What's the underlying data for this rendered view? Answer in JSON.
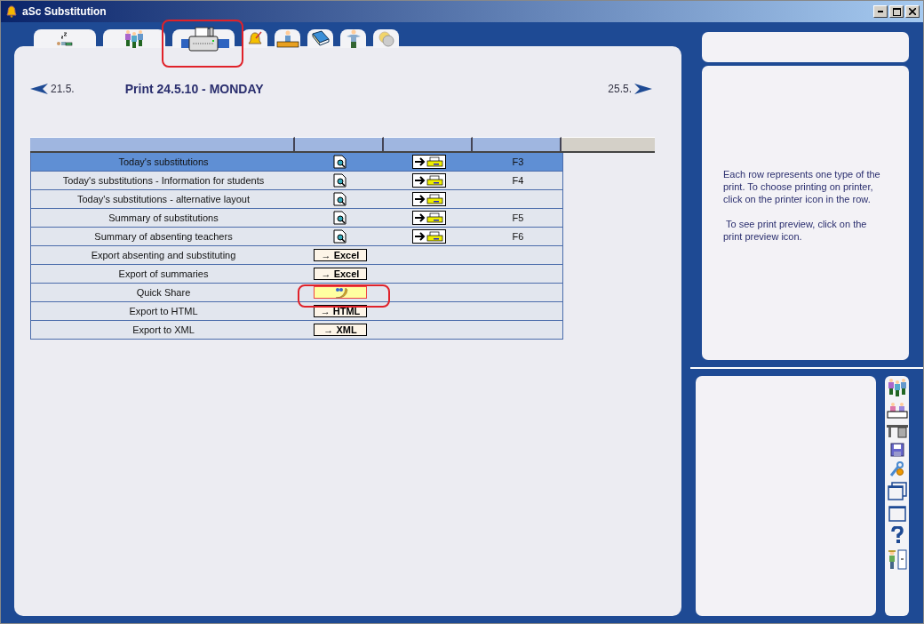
{
  "window": {
    "title": "aSc Substitution"
  },
  "tabs": [
    {
      "selected": false
    },
    {
      "selected": false
    },
    {
      "selected": true
    },
    {
      "selected": false
    },
    {
      "selected": false
    },
    {
      "selected": false
    },
    {
      "selected": false
    },
    {
      "selected": false
    }
  ],
  "nav": {
    "prev": "21.5.",
    "title": "Print 24.5.10 - MONDAY",
    "next": "25.5."
  },
  "rows": [
    {
      "kind": "print",
      "label": "Today's substitutions",
      "key": "F3",
      "selected": true
    },
    {
      "kind": "print",
      "label": "Today's substitutions - Information for students",
      "key": "F4",
      "selected": false
    },
    {
      "kind": "print",
      "label": "Today's substitutions - alternative layout",
      "selected": false
    },
    {
      "kind": "print",
      "label": "Summary of substitutions",
      "key": "F5",
      "selected": false
    },
    {
      "kind": "print",
      "label": "Summary of absenting teachers",
      "key": "F6",
      "selected": false
    },
    {
      "kind": "export",
      "label": "Export absenting and substituting",
      "button": "→ Excel",
      "selected": false
    },
    {
      "kind": "export",
      "label": "Export of summaries",
      "button": "→ Excel",
      "selected": false
    },
    {
      "kind": "share",
      "label": "Quick Share",
      "selected": false
    },
    {
      "kind": "export",
      "label": "Export to HTML",
      "button": "→ HTML",
      "selected": false
    },
    {
      "kind": "export",
      "label": "Export to XML",
      "button": "→ XML",
      "selected": false
    }
  ],
  "help": {
    "paragraphs": [
      "Each row represents one type of the print. To choose printing on printer, click on the printer icon in the row.",
      " To see print preview, click on the print preview icon."
    ]
  }
}
